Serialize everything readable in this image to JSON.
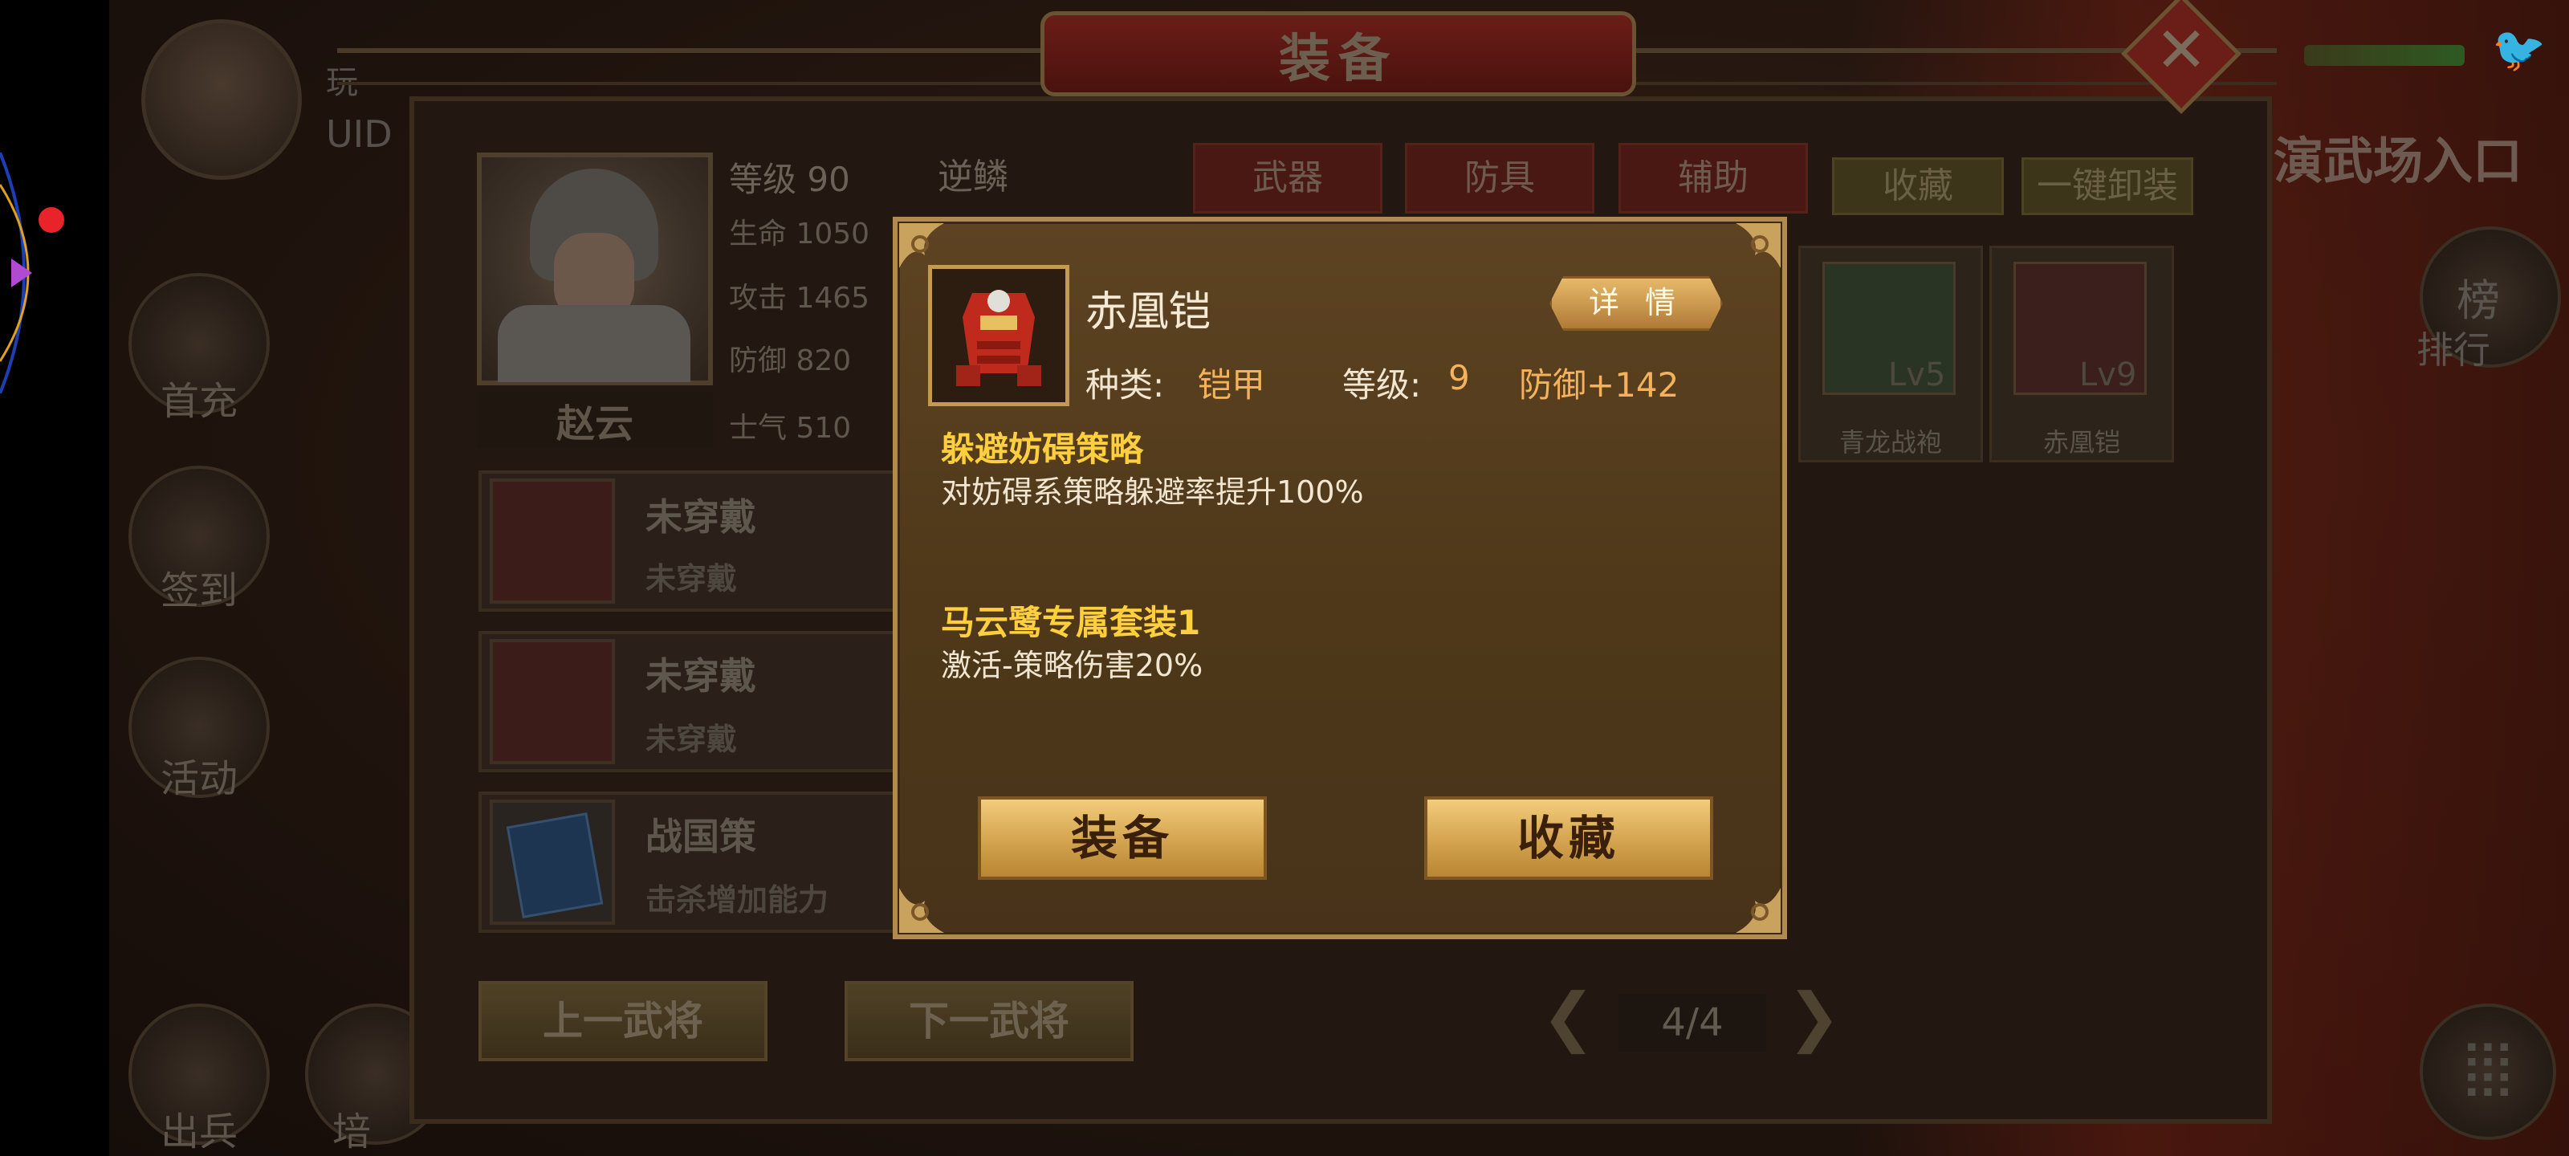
{
  "window": {
    "title": "装备"
  },
  "player": {
    "name_fragment": "玩",
    "uid_label": "UID"
  },
  "left_menu": [
    {
      "label": "首充"
    },
    {
      "label": "签到"
    },
    {
      "label": "活动"
    },
    {
      "label": "出兵"
    },
    {
      "label": "培"
    }
  ],
  "hero": {
    "name": "赵云",
    "level": "等级 90",
    "hp": "生命 1050",
    "attack": "攻击 1465",
    "defense": "防御 820",
    "morale": "士气 510",
    "skill": "逆鳞"
  },
  "slots": [
    {
      "title": "未穿戴",
      "subtitle": "未穿戴"
    },
    {
      "title": "未穿戴",
      "subtitle": "未穿戴"
    },
    {
      "title": "战国策",
      "subtitle": "击杀增加能力"
    }
  ],
  "nav_buttons": {
    "prev": "上一武将",
    "next": "下一武将"
  },
  "tabs": [
    {
      "label": "武器"
    },
    {
      "label": "防具"
    },
    {
      "label": "辅助"
    }
  ],
  "actions": {
    "favorites": "收藏",
    "unequip_all": "一键卸装"
  },
  "inventory": [
    {
      "name": "青龙战袍",
      "level": "Lv5"
    },
    {
      "name": "赤凰铠",
      "level": "Lv9"
    }
  ],
  "pager": {
    "text": "4/4"
  },
  "right_side": {
    "entrance": "演武场入口",
    "rank": "排行",
    "rank_icon_char": "榜"
  },
  "popup": {
    "item_name": "赤凰铠",
    "detail_button": "详 情",
    "type_label": "种类:",
    "type_value": "铠甲",
    "level_label": "等级:",
    "level_value": "9",
    "stat": "防御+142",
    "effects": [
      {
        "title": "躲避妨碍策略",
        "desc": "对妨碍系策略躲避率提升100%"
      },
      {
        "title": "马云鹭专属套装1",
        "desc": "激活-策略伤害20%"
      }
    ],
    "equip_button": "装备",
    "favorite_button": "收藏"
  },
  "colors": {
    "popup_bg": "#5d4322",
    "popup_border": "#b08a4e",
    "effect_title": "#ffcf3e",
    "value_accent": "#f4b35a",
    "button_gold": "#d6a652"
  },
  "icons": [
    "close-icon",
    "arrow-left-icon",
    "arrow-right-icon",
    "menu-icon",
    "bird-icon",
    "play-arrow-icon"
  ]
}
